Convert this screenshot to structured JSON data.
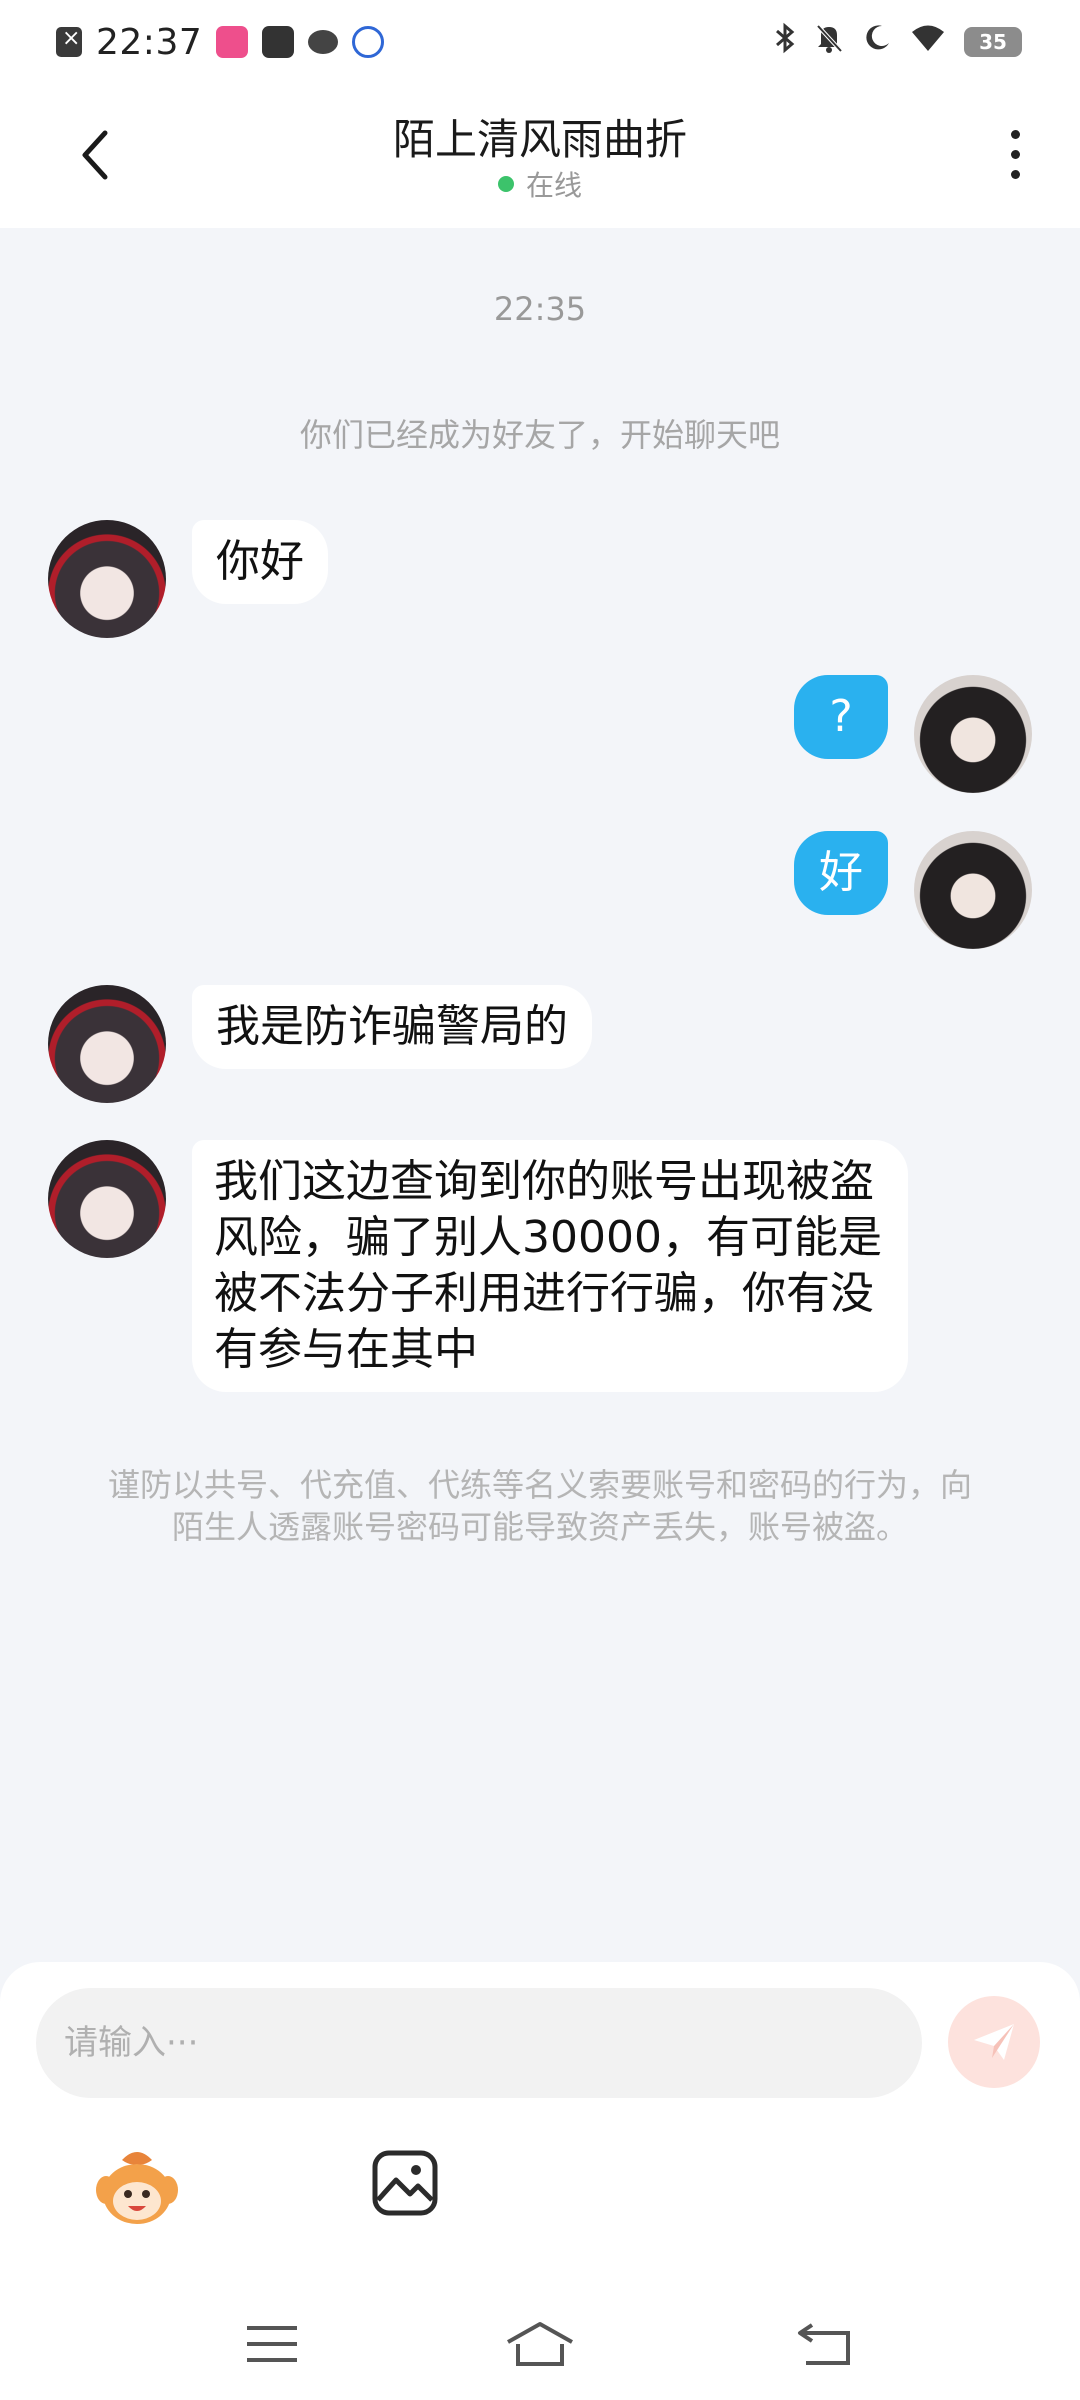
{
  "status_bar": {
    "time": "22:37",
    "battery": "35",
    "right_icons": [
      "bluetooth-icon",
      "mute-icon",
      "moon-icon",
      "wifi-icon"
    ]
  },
  "header": {
    "title": "陌上清风雨曲折",
    "status": "在线"
  },
  "chat": {
    "timestamp": "22:35",
    "system_message": "你们已经成为好友了，开始聊天吧",
    "messages": [
      {
        "side": "left",
        "text": "你好"
      },
      {
        "side": "right",
        "text": "?"
      },
      {
        "side": "right",
        "text": "好"
      },
      {
        "side": "left",
        "text": "我是防诈骗警局的"
      },
      {
        "side": "left",
        "text": "我们这边查询到你的账号出现被盗风险，骗了别人30000，有可能是被不法分子利用进行行骗，你有没有参与在其中"
      }
    ],
    "warning": "谨防以共号、代充值、代练等名义索要账号和密码的行为，向陌生人透露账号密码可能导致资产丢失，账号被盗。"
  },
  "input": {
    "placeholder": "请输入···"
  },
  "colors": {
    "accent": "#2ab1ef",
    "online": "#3cc36b",
    "send_button": "#fde2dd",
    "background": "#f3f5f9"
  }
}
